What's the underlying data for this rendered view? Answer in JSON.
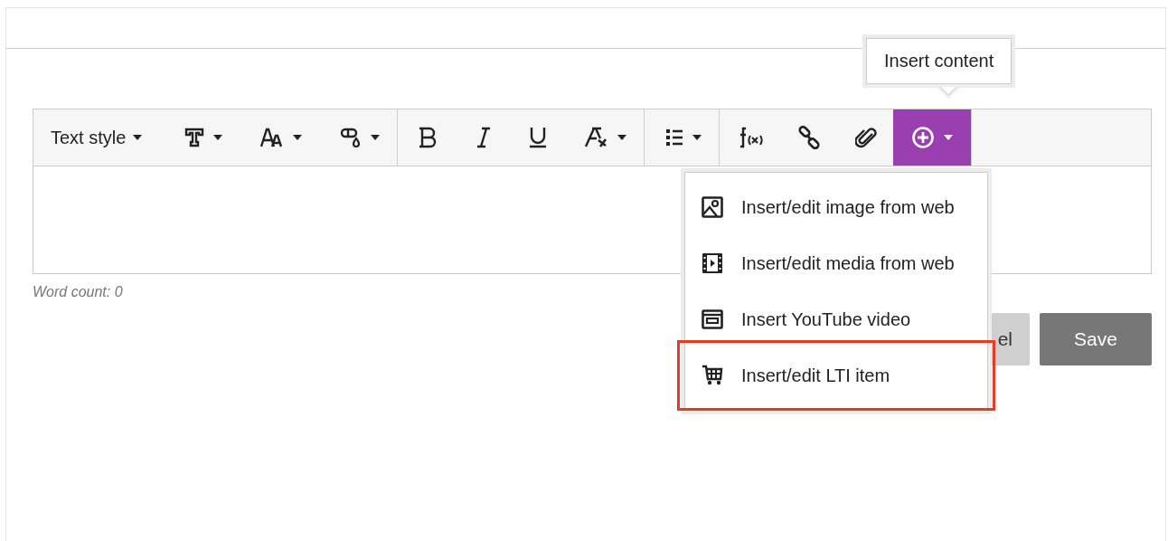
{
  "toolbar": {
    "groups": [
      {
        "items": [
          {
            "kind": "text",
            "label": "Text style",
            "has_dropdown": true,
            "active": false
          },
          {
            "kind": "icon",
            "has_dropdown": true,
            "active": false
          },
          {
            "kind": "icon",
            "has_dropdown": true,
            "active": false
          },
          {
            "kind": "icon",
            "has_dropdown": true,
            "active": false
          }
        ]
      },
      {
        "items": [
          {
            "kind": "icon",
            "has_dropdown": false,
            "active": false
          },
          {
            "kind": "icon",
            "has_dropdown": false,
            "active": false
          },
          {
            "kind": "icon",
            "has_dropdown": false,
            "active": false
          },
          {
            "kind": "icon",
            "has_dropdown": true,
            "active": false
          }
        ]
      },
      {
        "items": [
          {
            "kind": "icon",
            "has_dropdown": true,
            "active": false
          }
        ]
      },
      {
        "items": [
          {
            "kind": "icon",
            "has_dropdown": false,
            "active": false
          },
          {
            "kind": "icon",
            "has_dropdown": false,
            "active": false
          },
          {
            "kind": "icon",
            "has_dropdown": false,
            "active": false
          },
          {
            "kind": "icon",
            "has_dropdown": true,
            "active": true
          }
        ]
      }
    ]
  },
  "tooltip": "Insert content",
  "insert_menu": [
    {
      "label": "Insert/edit image from web",
      "highlighted": false
    },
    {
      "label": "Insert/edit media from web",
      "highlighted": false
    },
    {
      "label": "Insert YouTube video",
      "highlighted": false
    },
    {
      "label": "Insert/edit LTI item",
      "highlighted": true
    }
  ],
  "word_count": "Word count: 0",
  "buttons": [
    {
      "label": "el",
      "kind": "secondary"
    },
    {
      "label": "Save",
      "kind": "primary"
    }
  ]
}
